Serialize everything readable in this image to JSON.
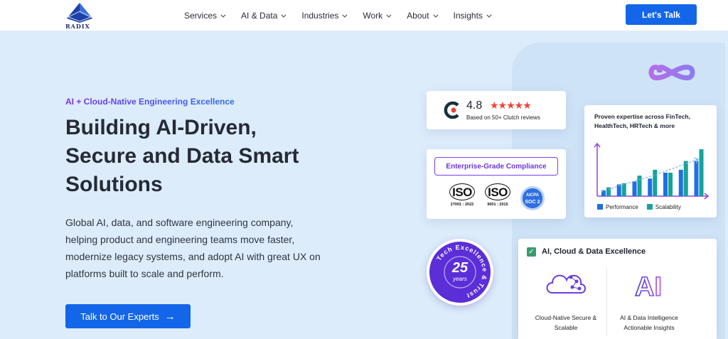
{
  "nav": {
    "brand": "RADIX",
    "items": [
      {
        "label": "Services"
      },
      {
        "label": "AI & Data"
      },
      {
        "label": "Industries"
      },
      {
        "label": "Work"
      },
      {
        "label": "About"
      },
      {
        "label": "Insights"
      }
    ],
    "cta": "Let's Talk"
  },
  "hero": {
    "eyebrow": "AI + Cloud-Native Engineering Excellence",
    "headline": [
      "Building AI-Driven,",
      "Secure and Data Smart",
      "Solutions"
    ],
    "description": "Global AI, data, and software engineering company, helping product and engineering teams move faster, modernize legacy systems, and adopt AI with great UX on platforms built to scale and perform.",
    "cta": "Talk to Our Experts",
    "cta_icon": "arrow-right-icon"
  },
  "clutch": {
    "rating": "4.8",
    "stars": "★★★★★",
    "subtext": "Based on 50+ Clutch reviews"
  },
  "compliance": {
    "title": "Enterprise-Grade Compliance",
    "badges": [
      {
        "mark": "ISO",
        "code": "27001 : 2022"
      },
      {
        "mark": "ISO",
        "code": "9001 : 2015"
      }
    ],
    "soc": {
      "top": "AICPA",
      "bottom": "SOC 2"
    }
  },
  "expertise": {
    "title": "Proven expertise across FinTech, HealthTech, HRTech & more",
    "legend": [
      {
        "label": "Performance",
        "color": "#1f6fe5"
      },
      {
        "label": "Scalability",
        "color": "#15a39a"
      }
    ],
    "performance": [
      1,
      2,
      2.5,
      3,
      4,
      4.5,
      6
    ],
    "scalability": [
      1.5,
      2.2,
      3.5,
      4.5,
      4,
      6,
      8
    ]
  },
  "trust_badge": {
    "ring_text": "Tech Excellence & Trust",
    "number": "25",
    "unit": "years"
  },
  "excellence": {
    "title": "AI, Cloud & Data Excellence",
    "items": [
      {
        "caption_1": "Cloud-Native Secure &",
        "caption_2": "Scalable",
        "icon": "cloud-network-icon"
      },
      {
        "caption_1": "AI & Data Intelligence",
        "caption_2": "Actionable Insights",
        "icon": "ai-icon",
        "icon_text": "AI"
      }
    ]
  },
  "colors": {
    "primary": "#1366e8",
    "accent_purple": "#6d36e0",
    "hero_bg": "#dcecfb"
  }
}
